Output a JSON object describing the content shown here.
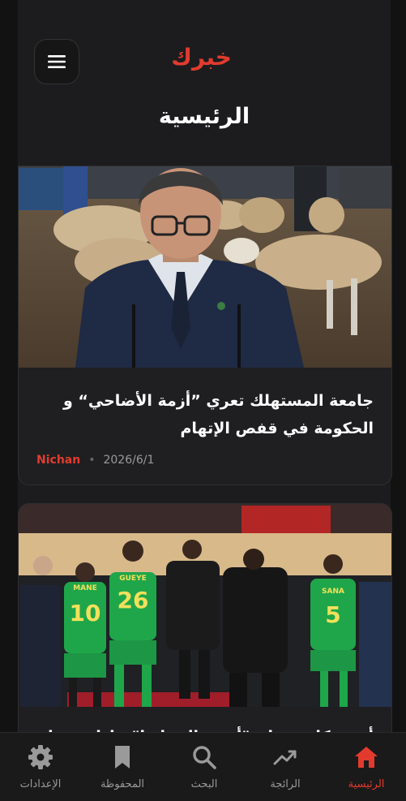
{
  "header": {
    "brand": "خبرك",
    "title": "الرئيسية",
    "menu_icon": "hamburger-menu-icon"
  },
  "articles": [
    {
      "title": "جامعة المستهلك تعري ”أزمة الأضاحي“ و الحكومة في قفص الإتهام",
      "source": "Nichan",
      "separator": "•",
      "date": "2026/6/1",
      "image": "politician-with-sheep-photo"
    },
    {
      "title": "أسود كانت تعلم \"أسود التيرانغا\" خاطئة حول",
      "image": "senegal-football-team-photo",
      "players": [
        "MANE",
        "10",
        "GUEYE",
        "26",
        "SANA",
        "5"
      ]
    }
  ],
  "nav": {
    "items": [
      {
        "label": "الرئيسية",
        "icon": "home-icon",
        "active": true
      },
      {
        "label": "الرائجة",
        "icon": "trending-icon",
        "active": false
      },
      {
        "label": "البحث",
        "icon": "search-icon",
        "active": false
      },
      {
        "label": "المحفوظة",
        "icon": "bookmark-icon",
        "active": false
      },
      {
        "label": "الإعدادات",
        "icon": "gear-icon",
        "active": false
      }
    ]
  },
  "colors": {
    "accent": "#e23b2e",
    "background": "#121212",
    "surface": "#1c1c1e",
    "muted_text": "#9a9a9a"
  }
}
